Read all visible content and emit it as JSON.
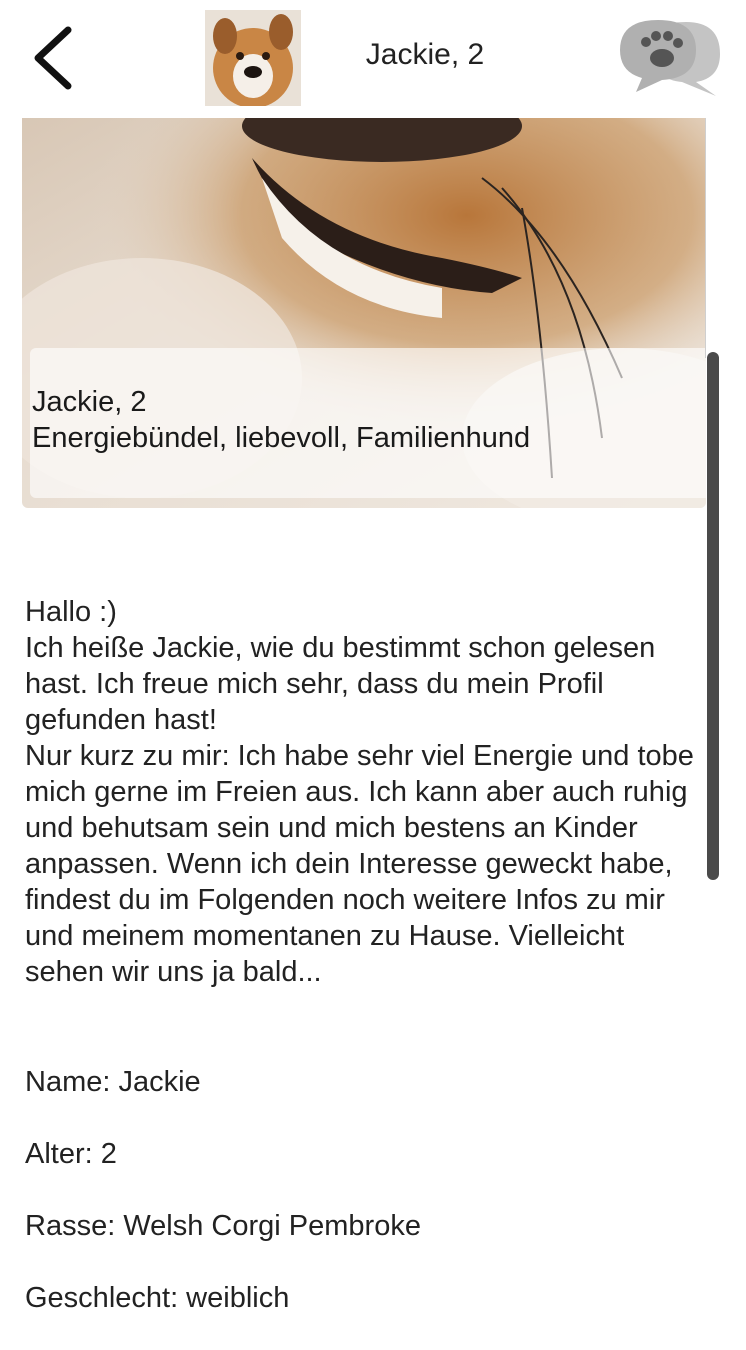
{
  "header": {
    "title": "Jackie, 2",
    "back_icon": "chevron-left-icon",
    "chat_icon": "paw-chat-icon"
  },
  "profile": {
    "overlay_name": "Jackie, 2",
    "overlay_tags": "Energiebündel, liebevoll, Familienhund"
  },
  "description": "Hallo :)\nIch heiße Jackie, wie du bestimmt schon gelesen hast. Ich freue mich sehr, dass du mein Profil gefunden hast!\nNur kurz zu mir: Ich habe sehr viel Energie und tobe mich gerne im Freien aus. Ich kann aber auch ruhig und behutsam sein und mich bestens an Kinder anpassen. Wenn ich dein Interesse geweckt habe, findest du im Folgenden noch weitere Infos zu mir und meinem momentanen zu Hause. Vielleicht sehen wir uns ja bald...",
  "facts": [
    "Name: Jackie",
    "Alter: 2",
    "Rasse: Welsh Corgi Pembroke",
    "Geschlecht: weiblich"
  ],
  "colors": {
    "scroll_thumb": "#4a4a4a",
    "chat_icon": "#b3b3b3"
  }
}
